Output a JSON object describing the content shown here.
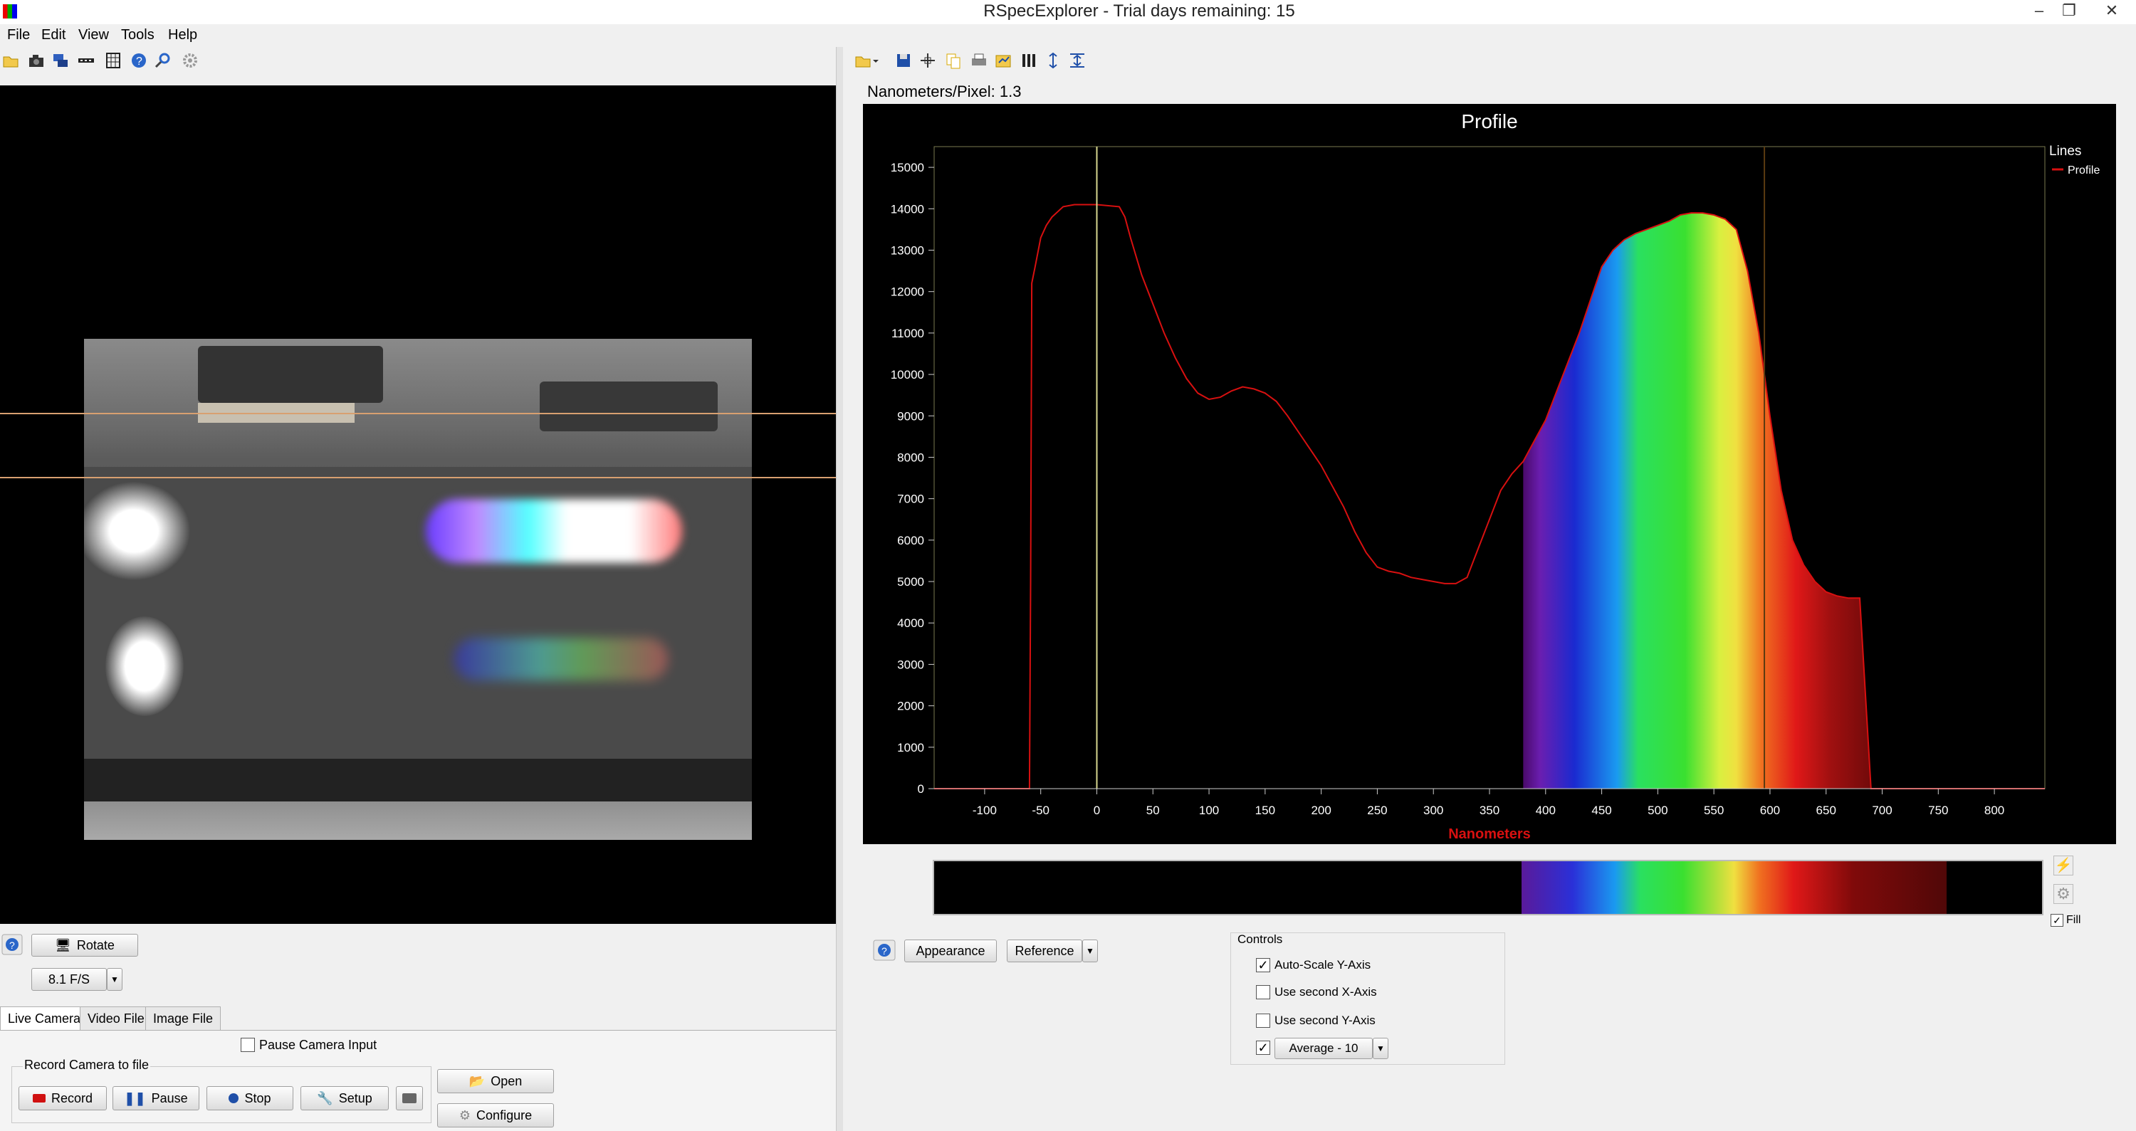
{
  "window": {
    "title": "RSpecExplorer -       Trial days remaining: 15",
    "controls": {
      "minimize": "–",
      "restore": "❐",
      "close": "✕"
    }
  },
  "menu": [
    "File",
    "Edit",
    "View",
    "Tools",
    "Help"
  ],
  "left_toolbar_icons": [
    "open-icon",
    "camera-icon",
    "layers-icon",
    "dots-icon",
    "grid-icon",
    "help-icon",
    "zoom-icon",
    "settings-icon"
  ],
  "right_toolbar_icons": [
    "open-folder-icon",
    "save-icon",
    "crosshair-icon",
    "copy-icon",
    "print-icon",
    "export-icon",
    "bars-icon",
    "vertical-arrows-icon",
    "fit-icon"
  ],
  "camera": {
    "rotate_label": "Rotate",
    "fps": "8.1 F/S",
    "tabs": [
      "Live Camera",
      "Video File",
      "Image File"
    ],
    "active_tab": "Live Camera",
    "pause_input_label": "Pause Camera Input",
    "record_group_label": "Record Camera to file",
    "buttons": {
      "record": "Record",
      "pause": "Pause",
      "stop": "Stop",
      "setup": "Setup",
      "open": "Open",
      "configure": "Configure"
    }
  },
  "spectrum": {
    "nm_per_pixel": "Nanometers/Pixel: 1.3",
    "legend_title": "Lines",
    "legend_item": "Profile",
    "fill_label": "Fill",
    "buttons": {
      "appearance": "Appearance",
      "reference": "Reference"
    },
    "controls": {
      "title": "Controls",
      "auto_scale_y": "Auto-Scale Y-Axis",
      "second_x": "Use second X-Axis",
      "second_y": "Use second Y-Axis",
      "average": "Average - 10"
    },
    "checks": {
      "auto_scale_y": true,
      "second_x": false,
      "second_y": false,
      "average": true,
      "fill": true
    }
  },
  "chart_data": {
    "type": "area",
    "title": "Profile",
    "xlabel": "Nanometers",
    "ylabel": "",
    "xlim": [
      -145,
      845
    ],
    "ylim": [
      0,
      15500
    ],
    "xticks": [
      -100,
      -50,
      0,
      50,
      100,
      150,
      200,
      250,
      300,
      350,
      400,
      450,
      500,
      550,
      600,
      650,
      700,
      750,
      800
    ],
    "yticks": [
      0,
      1000,
      2000,
      3000,
      4000,
      5000,
      6000,
      7000,
      8000,
      9000,
      10000,
      11000,
      12000,
      13000,
      14000,
      15000
    ],
    "legend": "top-right",
    "reference_lines": [
      0,
      595
    ],
    "fill_range": [
      380,
      760
    ],
    "series": [
      {
        "name": "Profile",
        "color": "#e00000",
        "x": [
          -145,
          -60,
          -59,
          -58,
          -55,
          -50,
          -45,
          -40,
          -30,
          -20,
          0,
          20,
          25,
          30,
          40,
          50,
          60,
          70,
          80,
          90,
          100,
          110,
          120,
          130,
          140,
          150,
          160,
          170,
          180,
          190,
          200,
          210,
          220,
          230,
          240,
          250,
          260,
          270,
          280,
          290,
          300,
          310,
          320,
          330,
          340,
          350,
          360,
          370,
          380,
          390,
          400,
          410,
          420,
          430,
          440,
          450,
          460,
          470,
          480,
          490,
          500,
          510,
          520,
          530,
          540,
          550,
          560,
          570,
          580,
          590,
          600,
          610,
          620,
          630,
          640,
          650,
          660,
          670,
          680,
          690,
          700,
          710,
          720,
          730,
          740,
          750,
          760,
          761,
          845
        ],
        "y": [
          0,
          0,
          5000,
          12200,
          12600,
          13300,
          13600,
          13800,
          14050,
          14100,
          14100,
          14050,
          13800,
          13300,
          12400,
          11700,
          11000,
          10400,
          9900,
          9550,
          9400,
          9450,
          9600,
          9700,
          9650,
          9550,
          9350,
          9000,
          8600,
          8200,
          7800,
          7300,
          6800,
          6200,
          5700,
          5350,
          5250,
          5200,
          5100,
          5050,
          5000,
          4950,
          4950,
          5100,
          5800,
          6500,
          7200,
          7600,
          7900,
          8400,
          8900,
          9600,
          10300,
          11000,
          11800,
          12600,
          13000,
          13250,
          13400,
          13500,
          13600,
          13700,
          13850,
          13900,
          13900,
          13850,
          13750,
          13500,
          12500,
          11000,
          9000,
          7200,
          6000,
          5400,
          5000,
          4750,
          4650,
          4600,
          4600,
          0,
          0,
          0,
          0,
          0,
          0,
          0,
          0,
          0,
          0
        ]
      }
    ]
  }
}
